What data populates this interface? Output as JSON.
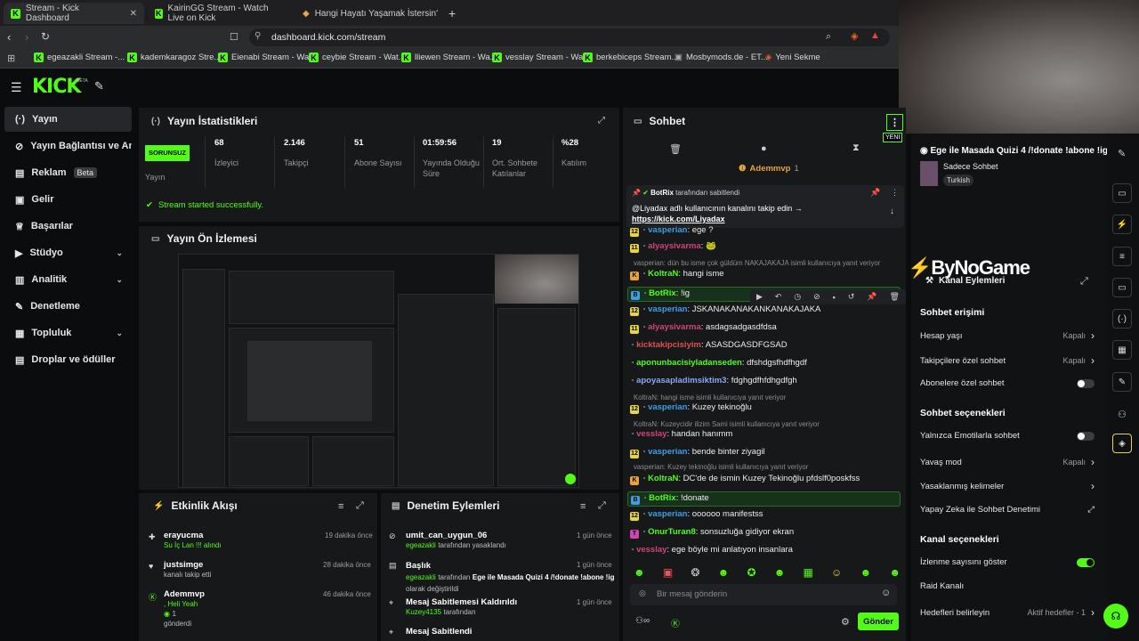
{
  "browser": {
    "tabs": [
      {
        "label": "Stream - Kick Dashboard"
      },
      {
        "label": "KairinGG Stream - Watch Live on Kick"
      },
      {
        "label": "Hangi Hayatı Yaşamak İstersin? - Tie"
      }
    ],
    "url": "dashboard.kick.com/stream",
    "bookmarks": [
      "egeazakli Stream -...",
      "kademkaragoz Stre...",
      "Eienabi Stream - Wa...",
      "ceybie Stream - Wat...",
      "lliewen Stream - Wa...",
      "vesslay Stream - Wa...",
      "berkebiceps Stream...",
      "Mosbymods.de - ET...",
      "Yeni Sekme"
    ]
  },
  "app": {
    "logo": "KICK",
    "logo_sup": "BETA"
  },
  "sidebar": {
    "items": [
      {
        "label": "Yayın"
      },
      {
        "label": "Yayın Bağlantısı ve Anahtar"
      },
      {
        "label": "Reklam",
        "badge": "Beta"
      },
      {
        "label": "Gelir"
      },
      {
        "label": "Başarılar"
      },
      {
        "label": "Stüdyo"
      },
      {
        "label": "Analitik"
      },
      {
        "label": "Denetleme"
      },
      {
        "label": "Topluluk"
      },
      {
        "label": "Droplar ve ödüller"
      }
    ]
  },
  "stats": {
    "title": "Yayın İstatistikleri",
    "status_badge": "SORUNSUZ",
    "status_label": "Yayın",
    "items": [
      {
        "value": "68",
        "label": "İzleyici"
      },
      {
        "value": "2.146",
        "label": "Takipçi"
      },
      {
        "value": "51",
        "label": "Abone Sayısı"
      },
      {
        "value": "01:59:56",
        "label": "Yayında Olduğu Süre"
      },
      {
        "value": "19",
        "label": "Ort. Sohbete Katılanlar"
      },
      {
        "value": "%28",
        "label": "Katılım"
      }
    ],
    "success_message": "Stream started successfully."
  },
  "preview": {
    "title": "Yayın Ön İzlemesi"
  },
  "activity": {
    "title": "Etkinlik Akışı",
    "items": [
      {
        "user": "erayucma",
        "detail": "Su İç Lan !!! alındı",
        "time": "19 dakika önce"
      },
      {
        "user": "justsimge",
        "detail": "kanalı takip etti",
        "time": "28 dakika önce"
      },
      {
        "user": "Ademmvp",
        "detail": ", Heli Yeah",
        "count": "1",
        "extra": "gönderdi",
        "time": "46 dakika önce"
      }
    ]
  },
  "moderation": {
    "title": "Denetim Eylemleri",
    "items": [
      {
        "user": "umit_can_uygun_06",
        "by": "egeazakli",
        "detail": "tarafından yasaklandı",
        "time": "1 gün önce"
      },
      {
        "user": "Başlık",
        "by": "egeazakli",
        "detail": "tarafından",
        "extra": "Ege ile Masada Quizi 4 /!donate !abone !ig",
        "extra2": "olarak değiştirildi",
        "time": "1 gün önce"
      },
      {
        "user": "Mesaj Sabitlemesi Kaldırıldı",
        "by": "Kuzey4135",
        "detail": "tarafından",
        "time": "1 gün önce"
      },
      {
        "user": "Mesaj Sabitlendi",
        "time": ""
      }
    ]
  },
  "chat": {
    "title": "Sohbet",
    "new_label": "YENİ",
    "top_user": "Ademmvp",
    "top_count": "1",
    "pinned": {
      "by": "BotRix",
      "by_suffix": "tarafından sabitlendi",
      "text": "@Liyadax adlı kullanıcının kanalını takip edin →",
      "link": "https://kick.com/Liyadax"
    },
    "messages": [
      {
        "badge": "12",
        "user": "vasperian",
        "text": ": ege ?"
      },
      {
        "badge": "11",
        "user": "alyaysivarma",
        "text": ": 🐸"
      },
      {
        "reply": "vasperian: dün bu isme çok güldüm NAKAJAKAJA isimli kullanıcıya yanıt veriyor"
      },
      {
        "badge": "K",
        "user": "KoltraN",
        "text": ": hangi isme"
      },
      {
        "badge": "B",
        "user": "BotRix",
        "text": ": !ig"
      },
      {
        "badge": "12",
        "user": "vasperian",
        "text": ": JSKANAKANAKANKANAKAJAKA"
      },
      {
        "badge": "11",
        "user": "alyaysivarma",
        "text": ": asdagsadgasdfdsa"
      },
      {
        "user": "kicktakipcisiyim",
        "text": ": ASASDGASDFGSAD"
      },
      {
        "user": "aponunbacisiyladanseden",
        "text": ": dfshdgsfhdfhgdf"
      },
      {
        "user": "apoyasapladimsiktim3",
        "text": ": fdghgdfhfdhgdfgh"
      },
      {
        "reply": "KoltraN: hangi isme isimli kullanıcıya yanıt veriyor"
      },
      {
        "badge": "12",
        "user": "vasperian",
        "text": ": Kuzey tekinoğlu"
      },
      {
        "reply": "KoltraN: Kuzeycidir ilizim Sami isimli kullanıcıya yanıt veriyor"
      },
      {
        "user": "vesslay",
        "text": ": handan hanımm"
      },
      {
        "badge": "12",
        "user": "vasperian",
        "text": ": bende binter ziyagil"
      },
      {
        "reply": "vasperian: Kuzey tekinoğlu isimli kullanıcıya yanıt veriyor"
      },
      {
        "badge": "K",
        "user": "KoltraN",
        "text": ": DC'de de ismin Kuzey Tekinoğlu pfdslf0poskfss"
      },
      {
        "badge": "B",
        "user": "BotRix",
        "text": ": !donate"
      },
      {
        "badge": "12",
        "user": "vasperian",
        "text": ": oooooo manifestss"
      },
      {
        "badge": "T",
        "user": "OnurTuran8",
        "text": ": sonsuzluğa gidiyor ekran"
      },
      {
        "user": "vesslay",
        "text": ": ege böyle mi anlatıyon insanlara"
      }
    ],
    "input_placeholder": "Bir mesaj gönderin",
    "send_label": "Gönder"
  },
  "stream_info": {
    "title": "Ege ile Masada Quizi 4 /!donate !abone !ig",
    "category": "Sadece Sohbet",
    "tag": "Turkish"
  },
  "overlay_logo": "ByNoGame",
  "channel_actions": {
    "title": "Kanal Eylemleri",
    "sections": [
      {
        "heading": "Sohbet erişimi",
        "rows": [
          {
            "label": "Hesap yaşı",
            "value": "Kapalı",
            "control": "arrow"
          },
          {
            "label": "Takipçilere özel sohbet",
            "value": "Kapalı",
            "control": "arrow"
          },
          {
            "label": "Abonelere özel sohbet",
            "value": "",
            "control": "toggle-off"
          }
        ]
      },
      {
        "heading": "Sohbet seçenekleri",
        "rows": [
          {
            "label": "Yalnızca Emotilarla sohbet",
            "value": "",
            "control": "toggle-off"
          },
          {
            "label": "Yavaş mod",
            "value": "Kapalı",
            "control": "arrow"
          },
          {
            "label": "Yasaklanmış kelimeler",
            "value": "",
            "control": "arrow"
          },
          {
            "label": "Yapay Zeka ile Sohbet Denetimi",
            "value": "",
            "control": "external"
          }
        ]
      },
      {
        "heading": "Kanal seçenekleri",
        "rows": [
          {
            "label": "İzlenme sayısını göster",
            "value": "",
            "control": "toggle-on"
          },
          {
            "label": "Raid Kanalı",
            "value": "",
            "control": "none"
          },
          {
            "label": "Hedefleri belirleyin",
            "value": "Aktif hedefler - 1",
            "control": "arrow"
          }
        ]
      }
    ]
  },
  "colors": {
    "accent": "#53fc18",
    "panel": "#17181a",
    "bg": "#0b0c0d"
  }
}
